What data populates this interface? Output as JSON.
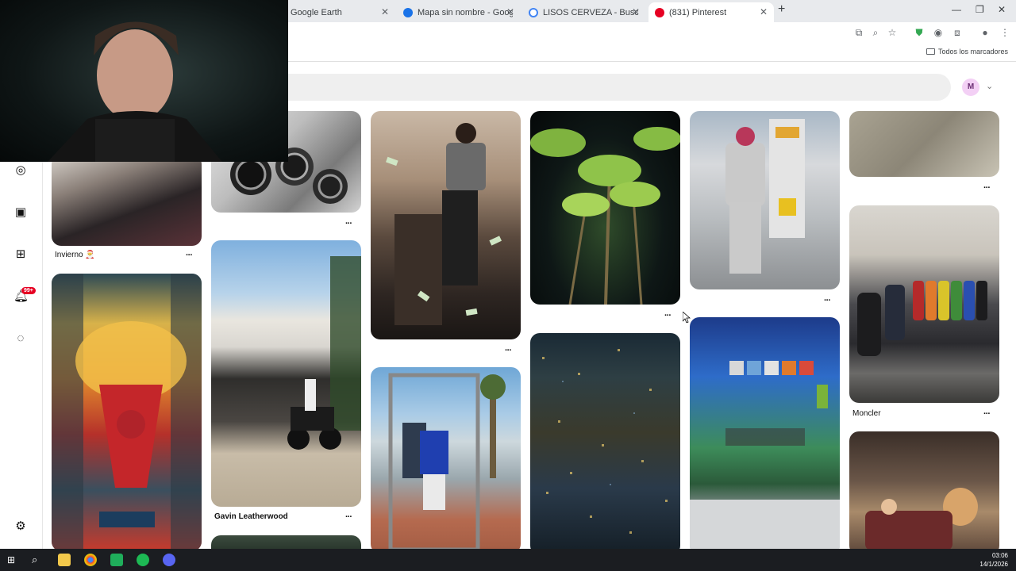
{
  "browser": {
    "tabs": [
      {
        "title": "Google Earth",
        "active": false
      },
      {
        "title": "Mapa sin nombre - Google Earth",
        "active": false
      },
      {
        "title": "LISOS CERVEZA - Buscar con Google",
        "active": false
      },
      {
        "title": "(831) Pinterest",
        "active": true
      }
    ],
    "bookmarks_label": "Todos los marcadores"
  },
  "header": {
    "avatar_initial": "M"
  },
  "sidebar": {
    "notification_badge": "99+",
    "icons": [
      "explore-icon",
      "boards-icon",
      "create-icon",
      "notifications-icon",
      "messages-icon",
      "settings-icon"
    ]
  },
  "pins": [
    {
      "label": "Invierno 🎅"
    },
    {
      "label": "Gavin Leatherwood"
    },
    {
      "label": "Moncler"
    }
  ],
  "taskbar": {
    "time": "03:06",
    "date": "14/1/2026"
  },
  "colors": {
    "pinterest_red": "#e60023",
    "avatar_bg": "#f3d0f5"
  }
}
